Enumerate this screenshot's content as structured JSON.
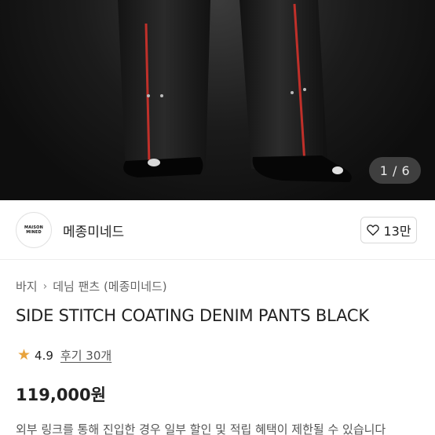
{
  "gallery": {
    "counter": "1 / 6"
  },
  "brand": {
    "logo_text": "MAISON MINED",
    "name": "메종미네드",
    "like_count": "13만"
  },
  "breadcrumb": {
    "category": "바지",
    "subcategory": "데님 팬츠 (메종미네드)"
  },
  "product": {
    "title": "SIDE STITCH COATING DENIM PANTS BLACK",
    "rating": "4.9",
    "reviews": "후기 30개",
    "price": "119,000원",
    "notice": "외부 링크를 통해 진입한 경우 일부 할인 및 적립 혜택이 제한될 수 있습니다"
  },
  "colors": {
    "star": "#e8a33c",
    "stitch": "#c0302a"
  }
}
